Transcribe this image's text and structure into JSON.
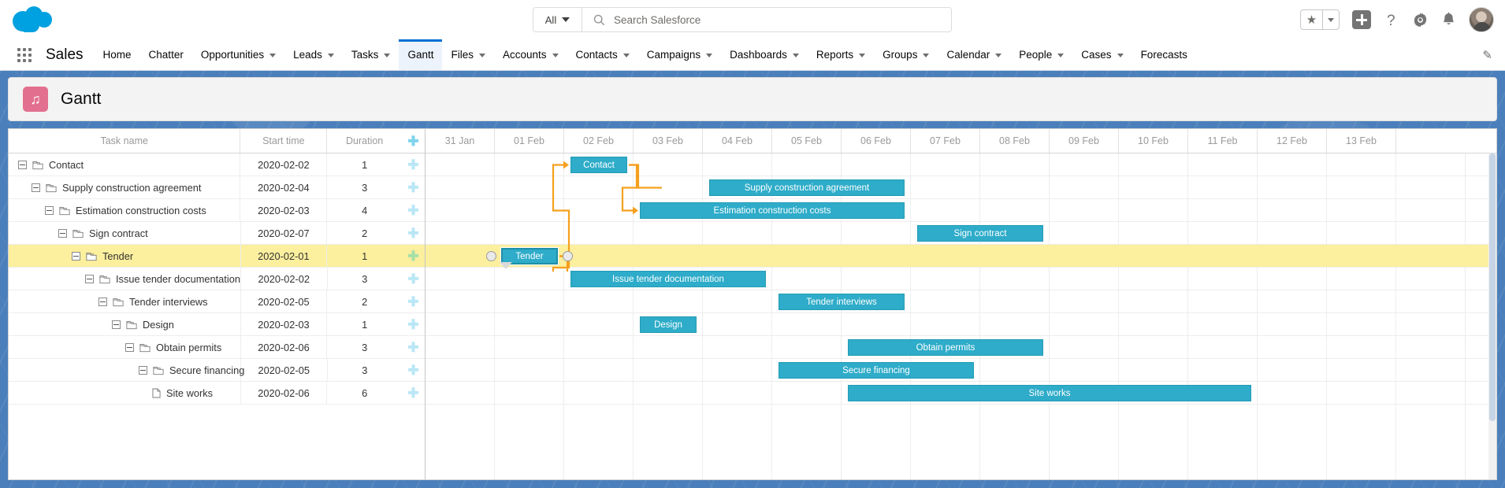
{
  "header": {
    "logo_name": "salesforce-cloud-logo",
    "search": {
      "scope": "All",
      "placeholder": "Search Salesforce",
      "value": ""
    },
    "icons": {
      "favorites": "star-icon",
      "favorites_caret": "chevron-down-icon",
      "add": "plus-icon",
      "help": "?",
      "setup": "gear-icon",
      "notifications": "bell-icon",
      "avatar": "user-avatar"
    }
  },
  "nav": {
    "app_launcher": "app-launcher-waffle",
    "app_name": "Sales",
    "edit_icon": "pencil-icon",
    "items": [
      {
        "label": "Home",
        "caret": false,
        "active": false
      },
      {
        "label": "Chatter",
        "caret": false,
        "active": false
      },
      {
        "label": "Opportunities",
        "caret": true,
        "active": false
      },
      {
        "label": "Leads",
        "caret": true,
        "active": false
      },
      {
        "label": "Tasks",
        "caret": true,
        "active": false
      },
      {
        "label": "Gantt",
        "caret": false,
        "active": true
      },
      {
        "label": "Files",
        "caret": true,
        "active": false
      },
      {
        "label": "Accounts",
        "caret": true,
        "active": false
      },
      {
        "label": "Contacts",
        "caret": true,
        "active": false
      },
      {
        "label": "Campaigns",
        "caret": true,
        "active": false
      },
      {
        "label": "Dashboards",
        "caret": true,
        "active": false
      },
      {
        "label": "Reports",
        "caret": true,
        "active": false
      },
      {
        "label": "Groups",
        "caret": true,
        "active": false
      },
      {
        "label": "Calendar",
        "caret": true,
        "active": false
      },
      {
        "label": "People",
        "caret": true,
        "active": false
      },
      {
        "label": "Cases",
        "caret": true,
        "active": false
      },
      {
        "label": "Forecasts",
        "caret": false,
        "active": false
      }
    ]
  },
  "page": {
    "title": "Gantt",
    "app_icon_glyph": "♫",
    "app_icon_color": "#e36f8e"
  },
  "grid": {
    "columns": [
      "Task name",
      "Start time",
      "Duration"
    ],
    "add_column_icon": "add-task-icon",
    "rows": [
      {
        "name": "Contact",
        "start": "2020-02-02",
        "duration": "1",
        "indent": 0,
        "leaf": false,
        "selected": false
      },
      {
        "name": "Supply construction agreement",
        "start": "2020-02-04",
        "duration": "3",
        "indent": 1,
        "leaf": false,
        "selected": false
      },
      {
        "name": "Estimation construction costs",
        "start": "2020-02-03",
        "duration": "4",
        "indent": 2,
        "leaf": false,
        "selected": false
      },
      {
        "name": "Sign contract",
        "start": "2020-02-07",
        "duration": "2",
        "indent": 3,
        "leaf": false,
        "selected": false
      },
      {
        "name": "Tender",
        "start": "2020-02-01",
        "duration": "1",
        "indent": 4,
        "leaf": false,
        "selected": true
      },
      {
        "name": "Issue tender documentation",
        "start": "2020-02-02",
        "duration": "3",
        "indent": 5,
        "leaf": false,
        "selected": false
      },
      {
        "name": "Tender interviews",
        "start": "2020-02-05",
        "duration": "2",
        "indent": 6,
        "leaf": false,
        "selected": false
      },
      {
        "name": "Design",
        "start": "2020-02-03",
        "duration": "1",
        "indent": 7,
        "leaf": false,
        "selected": false
      },
      {
        "name": "Obtain permits",
        "start": "2020-02-06",
        "duration": "3",
        "indent": 8,
        "leaf": false,
        "selected": false
      },
      {
        "name": "Secure financing",
        "start": "2020-02-05",
        "duration": "3",
        "indent": 9,
        "leaf": false,
        "selected": false
      },
      {
        "name": "Site works",
        "start": "2020-02-06",
        "duration": "6",
        "indent": 10,
        "leaf": true,
        "selected": false
      }
    ]
  },
  "chart_data": {
    "type": "bar",
    "title": "Gantt",
    "timeline_unit": "day",
    "timeline_ticks": [
      "31 Jan",
      "01 Feb",
      "02 Feb",
      "03 Feb",
      "04 Feb",
      "05 Feb",
      "06 Feb",
      "07 Feb",
      "08 Feb",
      "09 Feb",
      "10 Feb",
      "11 Feb",
      "12 Feb",
      "13 Feb"
    ],
    "bar_color": "#2eacc9",
    "link_color": "#f5a01e",
    "selected_row_color": "#fcef9e",
    "tasks": [
      {
        "name": "Contact",
        "start": "2020-02-02",
        "duration": 1,
        "col_start": 2,
        "selected": false
      },
      {
        "name": "Supply construction agreement",
        "start": "2020-02-04",
        "duration": 3,
        "col_start": 4,
        "selected": false
      },
      {
        "name": "Estimation construction costs",
        "start": "2020-02-03",
        "duration": 4,
        "col_start": 3,
        "selected": false
      },
      {
        "name": "Sign contract",
        "start": "2020-02-07",
        "duration": 2,
        "col_start": 7,
        "selected": false
      },
      {
        "name": "Tender",
        "start": "2020-02-01",
        "duration": 1,
        "col_start": 1,
        "selected": true
      },
      {
        "name": "Issue tender documentation",
        "start": "2020-02-02",
        "duration": 3,
        "col_start": 2,
        "selected": false
      },
      {
        "name": "Tender interviews",
        "start": "2020-02-05",
        "duration": 2,
        "col_start": 5,
        "selected": false
      },
      {
        "name": "Design",
        "start": "2020-02-03",
        "duration": 1,
        "col_start": 3,
        "selected": false
      },
      {
        "name": "Obtain permits",
        "start": "2020-02-06",
        "duration": 3,
        "col_start": 6,
        "selected": false
      },
      {
        "name": "Secure financing",
        "start": "2020-02-05",
        "duration": 3,
        "col_start": 5,
        "selected": false
      },
      {
        "name": "Site works",
        "start": "2020-02-06",
        "duration": 6,
        "col_start": 6,
        "selected": false
      }
    ],
    "dependencies": [
      {
        "from": "Tender",
        "to": "Contact"
      },
      {
        "from": "Contact",
        "to": "Supply construction agreement"
      },
      {
        "from": "Contact",
        "to": "Estimation construction costs"
      },
      {
        "from": "Supply construction agreement",
        "to": "Sign contract"
      },
      {
        "from": "Estimation construction costs",
        "to": "Sign contract"
      },
      {
        "from": "Tender",
        "to": "Issue tender documentation"
      },
      {
        "from": "Issue tender documentation",
        "to": "Tender interviews"
      },
      {
        "from": "Tender",
        "to": "Design"
      },
      {
        "from": "Design",
        "to": "Obtain permits"
      },
      {
        "from": "Design",
        "to": "Secure financing"
      },
      {
        "from": "Secure financing",
        "to": "Site works"
      }
    ]
  }
}
